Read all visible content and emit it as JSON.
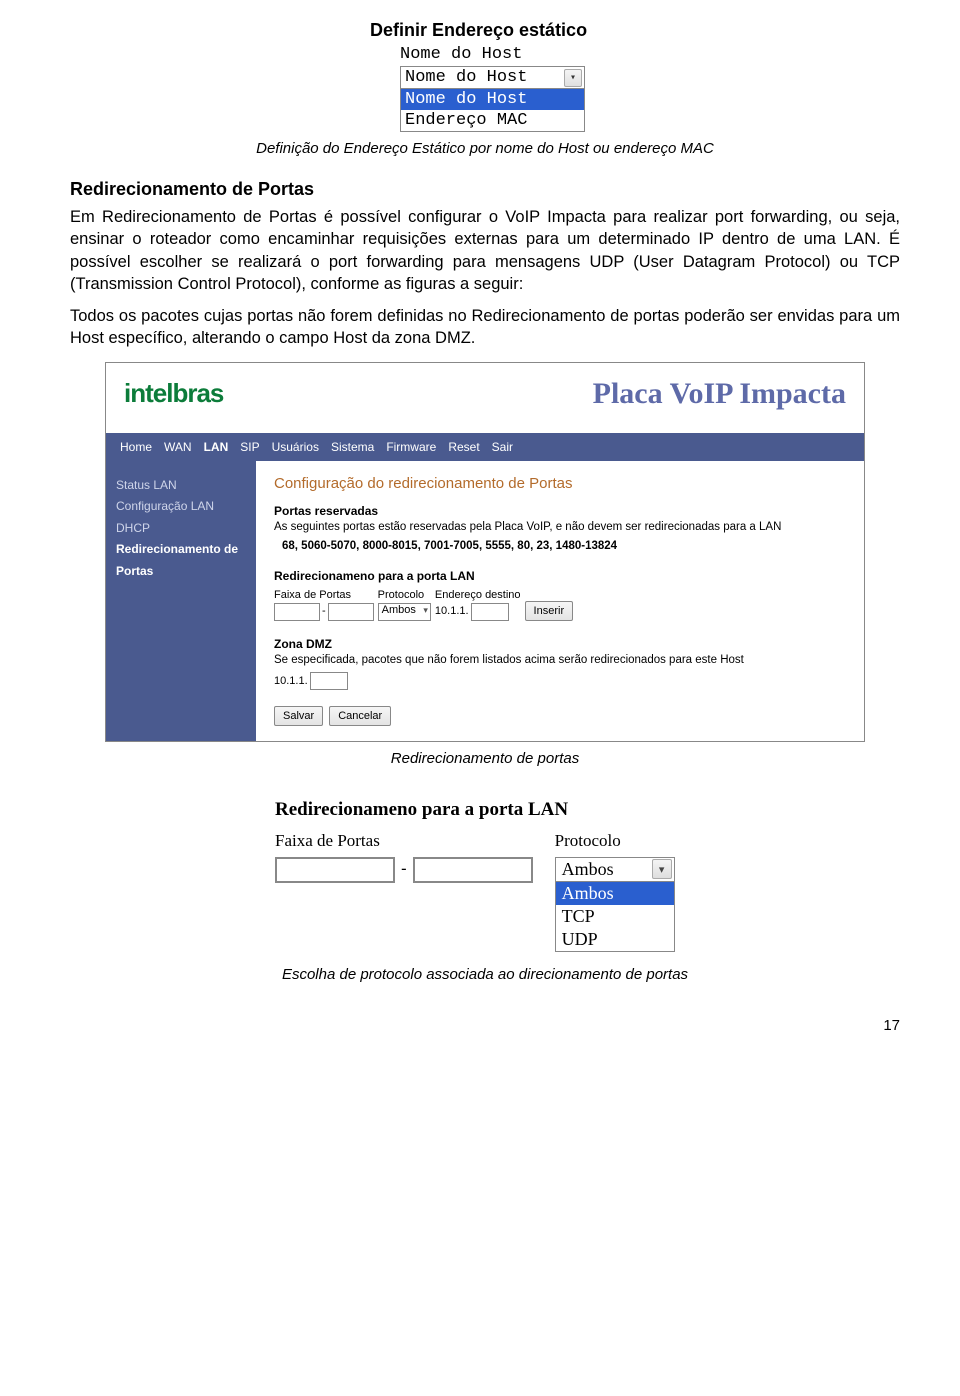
{
  "fig1": {
    "title": "Definir Endereço estático",
    "label": "Nome do Host",
    "selected": "Nome do Host",
    "option_hl": "Nome do Host",
    "option2": "Endereço MAC",
    "caption": "Definição do Endereço Estático por nome do Host ou endereço MAC"
  },
  "section": {
    "heading": "Redirecionamento de Portas",
    "para1": "Em Redirecionamento de Portas é possível configurar o VoIP Impacta para realizar port forwarding, ou seja, ensinar o roteador como encaminhar requisições externas para um determinado IP dentro de uma LAN. É possível escolher se realizará o port forwarding para mensagens UDP (User Datagram Protocol) ou TCP (Transmission Control Protocol), conforme as figuras a seguir:",
    "para2": "Todos os pacotes cujas portas não forem definidas no Redirecionamento de portas poderão ser envidas para um Host específico, alterando o campo Host da zona DMZ."
  },
  "webui": {
    "brand": "intelbras",
    "title": "Placa VoIP Impacta",
    "menu": [
      "Home",
      "WAN",
      "LAN",
      "SIP",
      "Usuários",
      "Sistema",
      "Firmware",
      "Reset",
      "Sair"
    ],
    "menu_active": "LAN",
    "sidebar": [
      "Status LAN",
      "Configuração LAN",
      "DHCP",
      "Redirecionamento de Portas"
    ],
    "sidebar_active": 3,
    "main_title": "Configuração do redirecionamento de Portas",
    "reserved_label": "Portas reservadas",
    "reserved_desc": "As seguintes portas estão reservadas pela Placa VoIP, e não devem ser redirecionadas para a LAN",
    "reserved_ports": "68, 5060-5070, 8000-8015, 7001-7005, 5555, 80, 23, 1480-13824",
    "lan_redirect_label": "Redirecionameno para a porta LAN",
    "col_faixa": "Faixa de Portas",
    "col_proto": "Protocolo",
    "col_dest": "Endereço destino",
    "proto_value": "Ambos",
    "dest_prefix": "10.1.1.",
    "insert_button": "Inserir",
    "dmz_label": "Zona DMZ",
    "dmz_desc": "Se especificada, pacotes que não forem listados acima serão redirecionados para este Host",
    "dmz_prefix": "10.1.1.",
    "save_button": "Salvar",
    "cancel_button": "Cancelar",
    "caption": "Redirecionamento de portas"
  },
  "fig3": {
    "title": "Redirecionameno para a porta LAN",
    "col_faixa": "Faixa de Portas",
    "col_proto": "Protocolo",
    "selected": "Ambos",
    "opt_hl": "Ambos",
    "opt2": "TCP",
    "opt3": "UDP",
    "caption": "Escolha de protocolo associada ao direcionamento de portas"
  },
  "page_number": "17"
}
